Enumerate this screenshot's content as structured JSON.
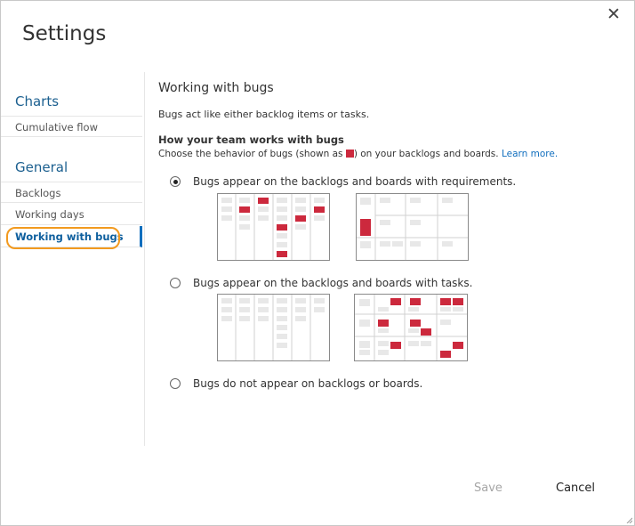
{
  "dialog": {
    "title": "Settings",
    "close_glyph": "✕"
  },
  "sidebar": {
    "groups": [
      {
        "heading": "Charts",
        "items": [
          "Cumulative flow"
        ]
      },
      {
        "heading": "General",
        "items": [
          "Backlogs",
          "Working days",
          "Working with bugs"
        ]
      }
    ],
    "active_item": "Working with bugs"
  },
  "main": {
    "title": "Working with bugs",
    "description": "Bugs act like either backlog items or tasks.",
    "section_heading": "How your team works with bugs",
    "section_desc_before": "Choose the behavior of bugs (shown as",
    "section_desc_after": ") on your backlogs and boards.",
    "learn_more": "Learn more.",
    "options": [
      {
        "label": "Bugs appear on the backlogs and boards with requirements.",
        "checked": true
      },
      {
        "label": "Bugs appear on the backlogs and boards with tasks.",
        "checked": false
      },
      {
        "label": "Bugs do not appear on backlogs or boards.",
        "checked": false
      }
    ]
  },
  "footer": {
    "save_label": "Save",
    "cancel_label": "Cancel"
  },
  "colors": {
    "bug": "#cc293d",
    "card": "#e8e8e8",
    "accent": "#106ebe",
    "highlight": "#f29a1f"
  },
  "icons": {
    "close": "close-icon",
    "bug_swatch": "bug-swatch-icon",
    "resize": "resize-grip-icon"
  }
}
